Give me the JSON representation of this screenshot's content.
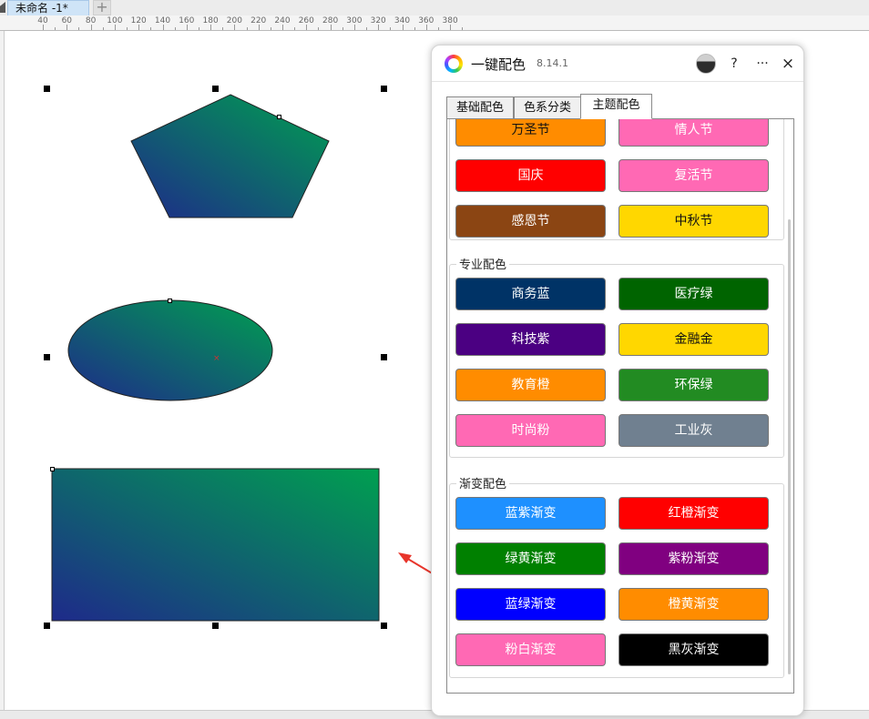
{
  "document": {
    "tab_label": "未命名 -1*",
    "new_tab_glyph": "+"
  },
  "ruler": {
    "labels": [
      "40",
      "60",
      "80",
      "100",
      "120",
      "140",
      "160",
      "180",
      "200",
      "220",
      "240",
      "260",
      "280",
      "300",
      "320",
      "340",
      "360",
      "380"
    ]
  },
  "docker": {
    "title": "一键配色",
    "version": "8.14.1",
    "help": "?",
    "more": "···",
    "close": "×",
    "tabs": [
      "基础配色",
      "色系分类",
      "主题配色"
    ],
    "active_tab": "主题配色",
    "holiday_buttons": [
      {
        "label": "万圣节",
        "color": "#ff8c00"
      },
      {
        "label": "情人节",
        "color": "#ff69b4"
      },
      {
        "label": "国庆",
        "color": "#ff0000"
      },
      {
        "label": "复活节",
        "color": "#ff69b4"
      },
      {
        "label": "感恩节",
        "color": "#8b4513"
      },
      {
        "label": "中秋节",
        "color": "#ffd700"
      }
    ],
    "professional": {
      "title": "专业配色",
      "buttons": [
        {
          "label": "商务蓝",
          "color": "#003366"
        },
        {
          "label": "医疗绿",
          "color": "#006400"
        },
        {
          "label": "科技紫",
          "color": "#4b0082"
        },
        {
          "label": "金融金",
          "color": "#ffd700"
        },
        {
          "label": "教育橙",
          "color": "#ff8c00"
        },
        {
          "label": "环保绿",
          "color": "#228b22"
        },
        {
          "label": "时尚粉",
          "color": "#ff69b4"
        },
        {
          "label": "工业灰",
          "color": "#708090"
        }
      ]
    },
    "gradient": {
      "title": "渐变配色",
      "buttons": [
        {
          "label": "蓝紫渐变",
          "color": "#1e90ff"
        },
        {
          "label": "红橙渐变",
          "color": "#ff0000"
        },
        {
          "label": "绿黄渐变",
          "color": "#008000"
        },
        {
          "label": "紫粉渐变",
          "color": "#800080"
        },
        {
          "label": "蓝绿渐变",
          "color": "#0000ff"
        },
        {
          "label": "橙黄渐变",
          "color": "#ff8c00"
        },
        {
          "label": "粉白渐变",
          "color": "#ff69b4"
        },
        {
          "label": "黑灰渐变",
          "color": "#000000"
        }
      ]
    }
  },
  "shapes": {
    "fill_gradient": {
      "start": "#1e2a8a",
      "end": "#00a050"
    },
    "items": [
      "pentagon",
      "ellipse",
      "rectangle"
    ]
  },
  "annotation": {
    "arrow_color": "#e8352b"
  }
}
